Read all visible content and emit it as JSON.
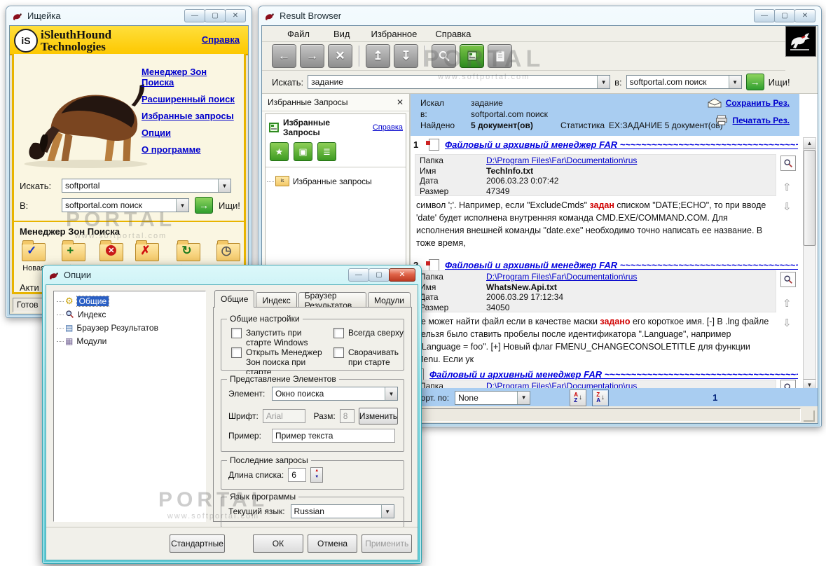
{
  "watermark": {
    "brand": "PORTAL",
    "url": "www.softportal.com"
  },
  "sleuth": {
    "title": "Ищейка",
    "logo_badge": "iS",
    "brand_line1": "iSleuthHound",
    "brand_line2": "Technologies",
    "help_link": "Справка",
    "nav": [
      "Менеджер Зон Поиска",
      "Расширенный поиск",
      "Избранные запросы",
      "Опции",
      "О программе"
    ],
    "search_label": "Искать:",
    "search_value": "softportal",
    "in_label": "В:",
    "in_value": "softportal.com поиск",
    "go_label": "Ищи!",
    "zones_title": "Менеджер Зон Поиска",
    "zone_buttons": [
      "Новая",
      "Добавить",
      "Стоп",
      "Удалить",
      "Обновить",
      "Расп."
    ],
    "active_text": "Акти",
    "status": "Готов"
  },
  "browser": {
    "title": "Result Browser",
    "menu": [
      "Файл",
      "Вид",
      "Избранное",
      "Справка"
    ],
    "toolbar": [
      {
        "name": "back",
        "glyph": "←"
      },
      {
        "name": "forward",
        "glyph": "→"
      },
      {
        "name": "stop",
        "glyph": "✕"
      },
      {
        "name": "up",
        "glyph": "↥"
      },
      {
        "name": "down",
        "glyph": "↧"
      }
    ],
    "search_label": "Искать:",
    "search_value": "задание",
    "in_label": "в:",
    "in_value": "softportal.com поиск",
    "go_label": "Ищи!",
    "fav": {
      "panel_title": "Избранные Запросы",
      "header": "Избранные Запросы",
      "help_link": "Справка",
      "tree_root": "Избранные запросы"
    },
    "header": {
      "searched_label": "Искал",
      "searched_value": "задание",
      "in_label": "в:",
      "in_value": "softportal.com поиск",
      "found_label": "Найдено",
      "found_value": "5 документ(ов)",
      "stats_label": "Статистика",
      "stats_value": "EX:ЗАДАНИЕ 5 документ(ов)",
      "save_link": "Сохранить Рез.",
      "print_link": "Печатать Рез."
    },
    "row_labels": {
      "folder": "Папка",
      "name": "Имя",
      "date": "Дата",
      "size": "Размер"
    },
    "results": [
      {
        "num": "1",
        "title": "Файловый и архивный менеджер FAR ~~~~~~~~~~~~~~~~~~~~~~~~~~~~~~~~~~~~~~~~~~~~~~~~",
        "folder": "D:\\Program Files\\Far\\Documentation\\rus",
        "name": "TechInfo.txt",
        "date": "2006.03.23  0:07:42",
        "size": "47349",
        "snippet_before": "символ ';'. Например, если \"ExcludeCmds\" ",
        "snippet_hl": "задан",
        "snippet_after": " списком \"DATE;ECHO\", то при вводе 'date' будет исполнена внутренняя команда CMD.EXE/COMMAND.COM. Для исполнения внешней команды \"date.exe\" необходимо точно написать ее название. В тоже время,"
      },
      {
        "num": "2",
        "title": "Файловый и архивный менеджер FAR ~~~~~~~~~~~~~~~~~~~~~~~~~~~~~~~~~~~~~~~~~~~~~~~~",
        "folder": "D:\\Program Files\\Far\\Documentation\\rus",
        "name": "WhatsNew.Api.txt",
        "date": "2006.03.29  17:12:34",
        "size": "34050",
        "snippet_before": "не может найти файл если в качестве маски ",
        "snippet_hl": "задано",
        "snippet_after": " его короткое имя. [-] В .lng файле нельзя было ставить пробелы после идентификатора \".Language\", например \".Language = foo\". [+] Новый флаг FMENU_CHANGECONSOLETITLE для функции Menu. Если ук"
      },
      {
        "num": "",
        "title": "Файловый и архивный менеджер FAR ~~~~~~~~~~~~~~~~~~~~~~~~~~~~~~~~~~~~~~~~~~~~~~~~",
        "folder": "D:\\Program Files\\Far\\Documentation\\rus"
      }
    ],
    "sort": {
      "label": "Сорт. по:",
      "value": "None",
      "az_top": "A",
      "az_bottom": "Z",
      "za_top": "Z",
      "za_bottom": "A",
      "page": "1"
    }
  },
  "options": {
    "title": "Опции",
    "tree": [
      "Общие",
      "Индекс",
      "Браузер Результатов",
      "Модули"
    ],
    "tabs": [
      "Общие",
      "Индекс",
      "Браузер Результатов",
      "Модули"
    ],
    "general_group": {
      "title": "Общие настройки",
      "checkboxes": [
        "Запустить при старте Windows",
        "Всегда сверху",
        "Открыть Менеджер Зон поиска при старте",
        "Сворачивать при старте"
      ]
    },
    "presentation_group": {
      "title": "Представление Элементов",
      "element_label": "Элемент:",
      "element_value": "Окно поиска",
      "font_label": "Шрифт:",
      "font_value": "Arial",
      "size_label": "Разм:",
      "size_value": "8",
      "change_button": "Изменить",
      "sample_label": "Пример:",
      "sample_value": "Пример текста"
    },
    "recent_group": {
      "title": "Последние запросы",
      "length_label": "Длина списка:",
      "length_value": "6"
    },
    "language_group": {
      "title": "Язык программы",
      "current_label": "Текущий язык:",
      "current_value": "Russian"
    },
    "buttons": {
      "defaults": "Стандартные",
      "ok": "ОК",
      "cancel": "Отмена",
      "apply": "Применить"
    }
  }
}
